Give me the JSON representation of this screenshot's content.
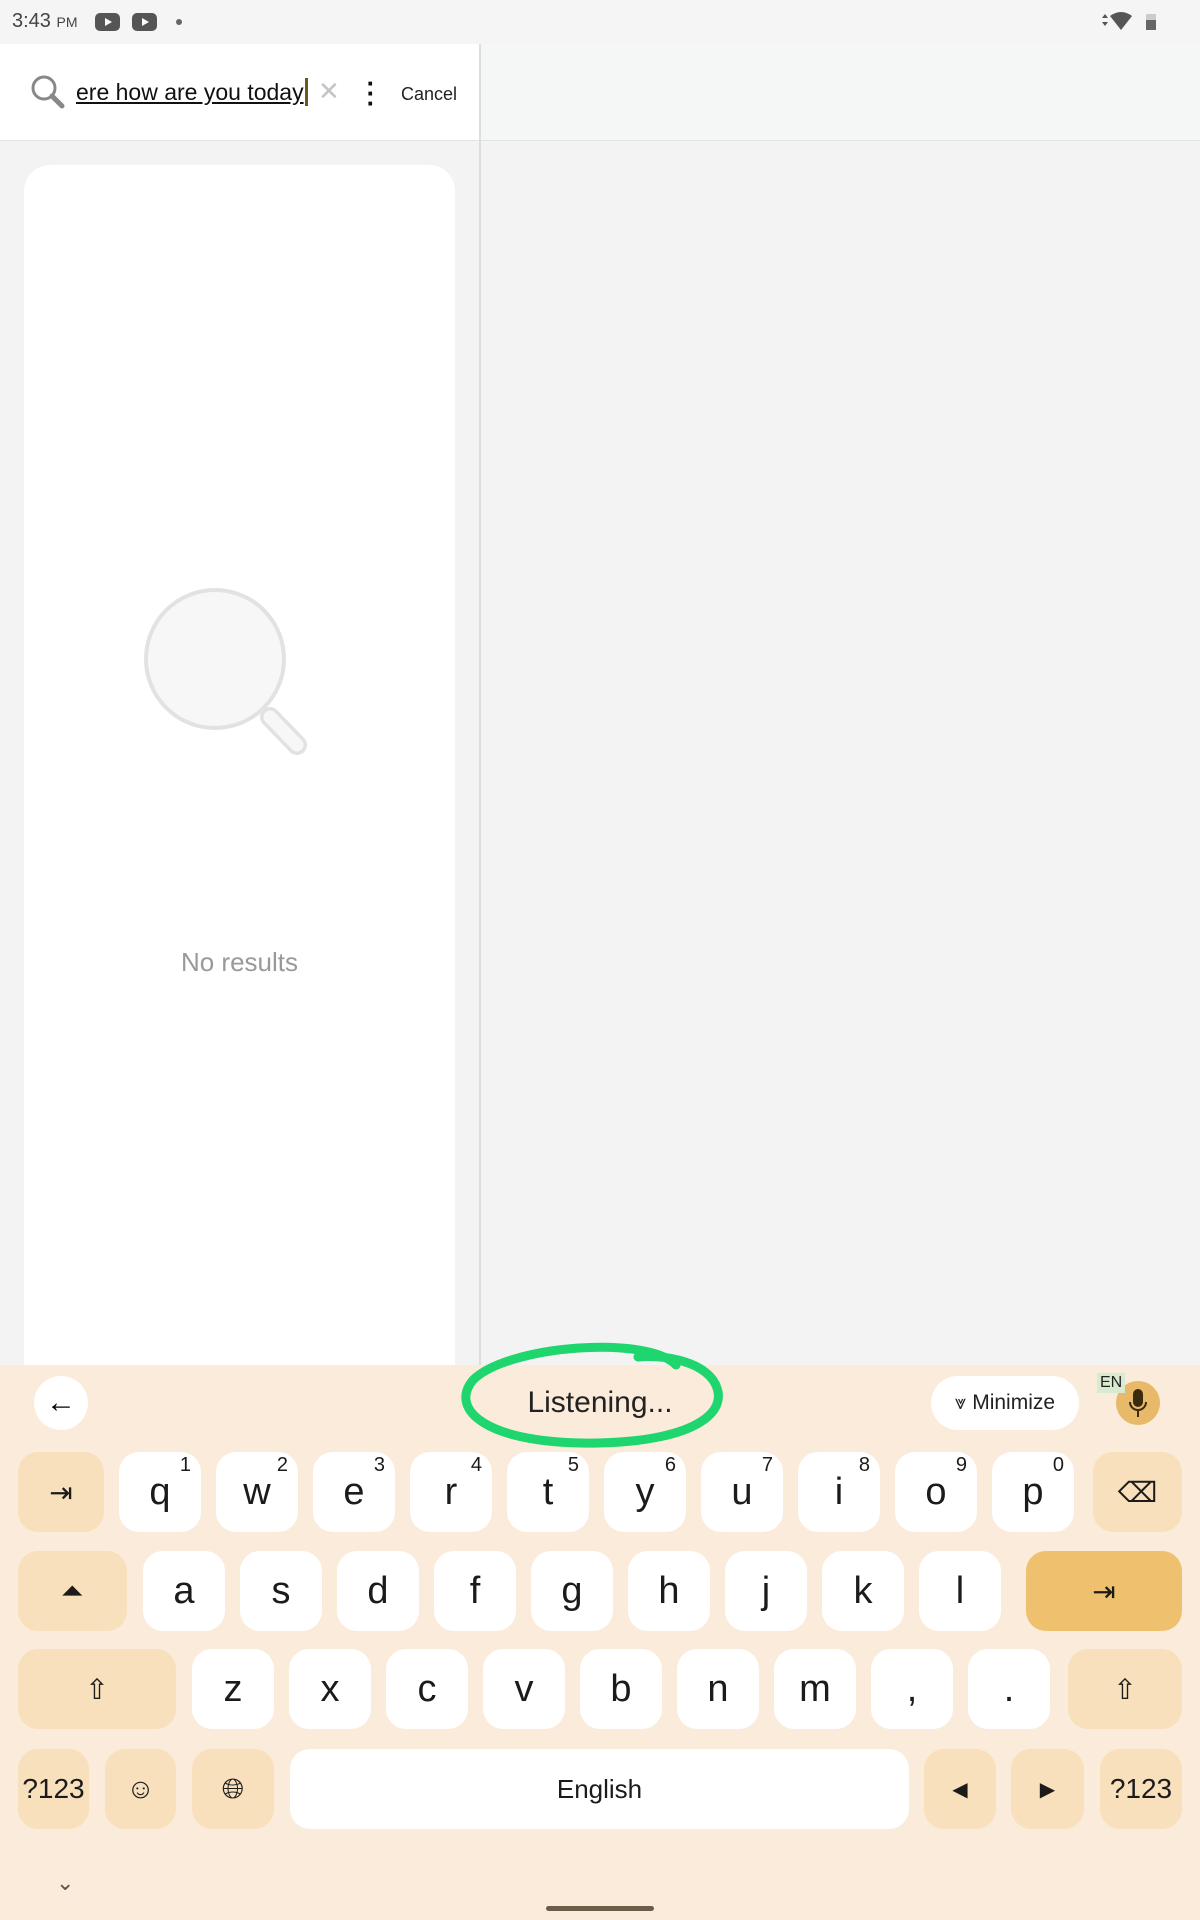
{
  "status_bar": {
    "time": "3:43",
    "ampm": "PM",
    "icons": [
      "youtube-icon",
      "youtube-icon",
      "dot-icon",
      "data-arrows-icon",
      "wifi-icon",
      "battery-icon"
    ]
  },
  "search": {
    "query": "ere how are you today",
    "cancel_label": "Cancel",
    "icons": [
      "search-icon",
      "clear-icon",
      "more-vert-icon"
    ]
  },
  "results": {
    "empty_text": "No results"
  },
  "keyboard": {
    "toolbar": {
      "listening": "Listening...",
      "minimize": "Minimize",
      "language_badge": "EN",
      "highlight_color": "#1ed66d"
    },
    "row1": [
      [
        "q",
        "1"
      ],
      [
        "w",
        "2"
      ],
      [
        "e",
        "3"
      ],
      [
        "r",
        "4"
      ],
      [
        "t",
        "5"
      ],
      [
        "y",
        "6"
      ],
      [
        "u",
        "7"
      ],
      [
        "i",
        "8"
      ],
      [
        "o",
        "9"
      ],
      [
        "p",
        "0"
      ]
    ],
    "row2": [
      "a",
      "s",
      "d",
      "f",
      "g",
      "h",
      "j",
      "k",
      "l"
    ],
    "row3": [
      "z",
      "x",
      "c",
      "v",
      "b",
      "n",
      "m",
      ",",
      "."
    ],
    "symbols_label": "?123",
    "space_label": "English",
    "colors": {
      "background": "#fbebdb",
      "special_key": "#f8e0bd",
      "enter_key": "#efc06e"
    }
  }
}
